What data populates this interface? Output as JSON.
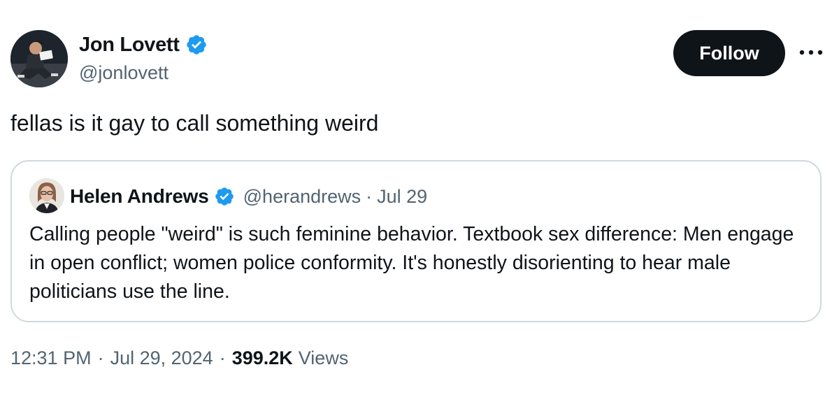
{
  "tweet": {
    "author": {
      "name": "Jon Lovett",
      "handle": "@jonlovett",
      "verified": true
    },
    "follow_label": "Follow",
    "more_icon": "more-horizontal-icon",
    "text": "fellas is it gay to call something weird",
    "quoted": {
      "author_name": "Helen Andrews",
      "handle": "@herandrews",
      "separator": "·",
      "date": "Jul 29",
      "verified": true,
      "text": "Calling people \"weird\" is such feminine behavior. Textbook sex difference: Men engage in open conflict; women police conformity. It's honestly disorienting to hear male politicians use the line."
    },
    "meta": {
      "time": "12:31 PM",
      "separator": "·",
      "date": "Jul 29, 2024",
      "views_count": "399.2K",
      "views_label": "Views"
    }
  },
  "colors": {
    "text_primary": "#0f1419",
    "text_secondary": "#536471",
    "border": "#cfd9de",
    "verified_blue": "#1d9bf0",
    "button_bg": "#0f1419"
  }
}
